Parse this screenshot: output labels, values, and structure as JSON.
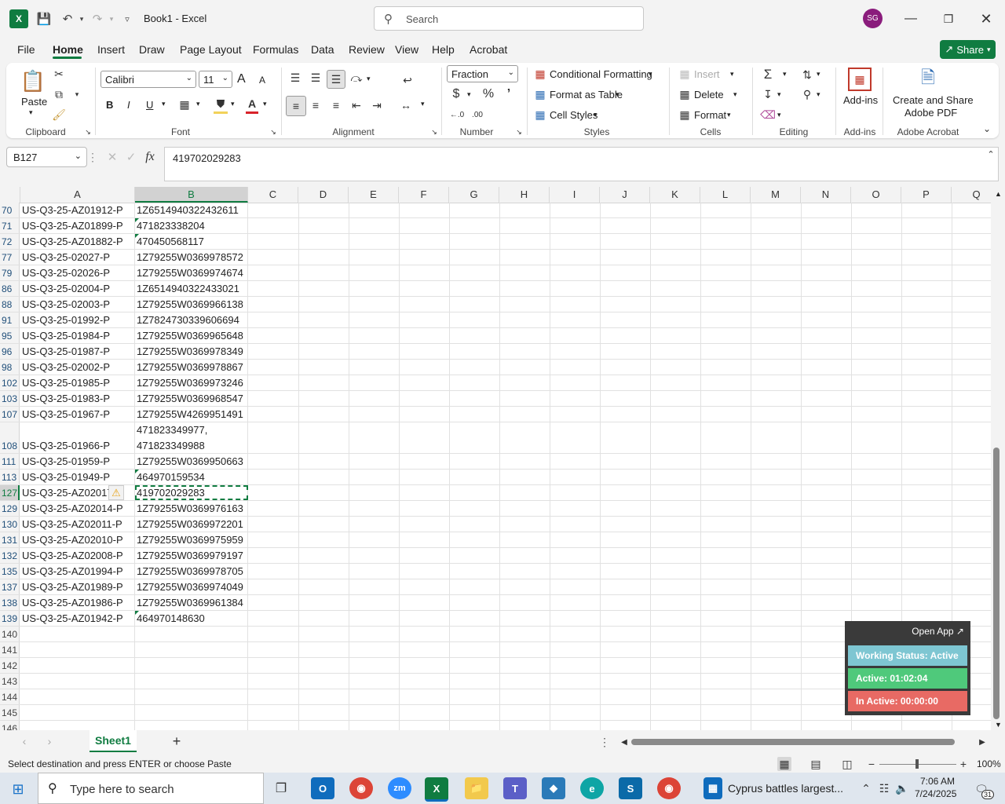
{
  "titlebar": {
    "title": "Book1  -  Excel",
    "search_placeholder": "Search",
    "avatar_initials": "SG"
  },
  "menu": {
    "tabs": [
      "File",
      "Home",
      "Insert",
      "Draw",
      "Page Layout",
      "Formulas",
      "Data",
      "Review",
      "View",
      "Help",
      "Acrobat"
    ],
    "share": "Share"
  },
  "ribbon": {
    "clipboard": {
      "paste": "Paste",
      "label": "Clipboard"
    },
    "font": {
      "name": "Calibri",
      "size": "11",
      "label": "Font",
      "bold": "B",
      "italic": "I",
      "underline": "U",
      "grow": "A",
      "shrink": "A"
    },
    "alignment": {
      "label": "Alignment"
    },
    "number": {
      "format": "Fraction",
      "label": "Number"
    },
    "styles": {
      "conditional": "Conditional Formatting",
      "format_table": "Format as Table",
      "cell_styles": "Cell Styles",
      "label": "Styles"
    },
    "cells": {
      "insert": "Insert",
      "delete": "Delete",
      "format": "Format",
      "label": "Cells"
    },
    "editing": {
      "label": "Editing"
    },
    "addins": {
      "button": "Add-ins",
      "label": "Add-ins"
    },
    "acrobat": {
      "line1": "Create and Share",
      "line2": "Adobe PDF",
      "label": "Adobe Acrobat"
    }
  },
  "formula_bar": {
    "name_box": "B127",
    "fx": "fx",
    "value": "419702029283"
  },
  "columns": [
    "A",
    "B",
    "C",
    "D",
    "E",
    "F",
    "G",
    "H",
    "I",
    "J",
    "K",
    "L",
    "M",
    "N",
    "O",
    "P",
    "Q"
  ],
  "rows": [
    {
      "num": "70",
      "a": "US-Q3-25-AZ01912-P",
      "b": "1Z6514940322432611",
      "tri": false
    },
    {
      "num": "71",
      "a": "US-Q3-25-AZ01899-P",
      "b": "471823338204",
      "tri": true
    },
    {
      "num": "72",
      "a": "US-Q3-25-AZ01882-P",
      "b": "470450568117",
      "tri": true
    },
    {
      "num": "77",
      "a": "US-Q3-25-02027-P",
      "b": "1Z79255W0369978572",
      "tri": false
    },
    {
      "num": "79",
      "a": "US-Q3-25-02026-P",
      "b": "1Z79255W0369974674",
      "tri": false
    },
    {
      "num": "86",
      "a": "US-Q3-25-02004-P",
      "b": "1Z6514940322433021",
      "tri": false
    },
    {
      "num": "88",
      "a": "US-Q3-25-02003-P",
      "b": "1Z79255W0369966138",
      "tri": false
    },
    {
      "num": "91",
      "a": "US-Q3-25-01992-P",
      "b": "1Z7824730339606694",
      "tri": false
    },
    {
      "num": "95",
      "a": "US-Q3-25-01984-P",
      "b": "1Z79255W0369965648",
      "tri": false
    },
    {
      "num": "96",
      "a": "US-Q3-25-01987-P",
      "b": "1Z79255W0369978349",
      "tri": false
    },
    {
      "num": "98",
      "a": "US-Q3-25-02002-P",
      "b": "1Z79255W0369978867",
      "tri": false
    },
    {
      "num": "102",
      "a": "US-Q3-25-01985-P",
      "b": "1Z79255W0369973246",
      "tri": false
    },
    {
      "num": "103",
      "a": "US-Q3-25-01983-P",
      "b": "1Z79255W0369968547",
      "tri": false
    },
    {
      "num": "107",
      "a": "US-Q3-25-01967-P",
      "b": "1Z79255W4269951491",
      "tri": false
    }
  ],
  "row108": {
    "num": "108",
    "a": "US-Q3-25-01966-P",
    "b1": "471823349977,",
    "b2": "471823349988"
  },
  "rows2": [
    {
      "num": "111",
      "a": "US-Q3-25-01959-P",
      "b": "1Z79255W0369950663",
      "tri": false
    },
    {
      "num": "113",
      "a": "US-Q3-25-01949-P",
      "b": "464970159534",
      "tri": true
    },
    {
      "num": "127",
      "a": "US-Q3-25-AZ02017",
      "b": "419702029283",
      "tri": false
    },
    {
      "num": "129",
      "a": "US-Q3-25-AZ02014-P",
      "b": "1Z79255W0369976163",
      "tri": false
    },
    {
      "num": "130",
      "a": "US-Q3-25-AZ02011-P",
      "b": "1Z79255W0369972201",
      "tri": false
    },
    {
      "num": "131",
      "a": "US-Q3-25-AZ02010-P",
      "b": "1Z79255W0369975959",
      "tri": false
    },
    {
      "num": "132",
      "a": "US-Q3-25-AZ02008-P",
      "b": "1Z79255W0369979197",
      "tri": false
    },
    {
      "num": "135",
      "a": "US-Q3-25-AZ01994-P",
      "b": "1Z79255W0369978705",
      "tri": false
    },
    {
      "num": "137",
      "a": "US-Q3-25-AZ01989-P",
      "b": "1Z79255W0369974049",
      "tri": false
    },
    {
      "num": "138",
      "a": "US-Q3-25-AZ01986-P",
      "b": "1Z79255W0369961384",
      "tri": false
    },
    {
      "num": "139",
      "a": "US-Q3-25-AZ01942-P",
      "b": "464970148630",
      "tri": true
    },
    {
      "num": "140",
      "a": "",
      "b": "",
      "tri": false
    },
    {
      "num": "141",
      "a": "",
      "b": "",
      "tri": false
    },
    {
      "num": "142",
      "a": "",
      "b": "",
      "tri": false
    },
    {
      "num": "143",
      "a": "",
      "b": "",
      "tri": false
    },
    {
      "num": "144",
      "a": "",
      "b": "",
      "tri": false
    },
    {
      "num": "145",
      "a": "",
      "b": "",
      "tri": false
    },
    {
      "num": "146",
      "a": "",
      "b": "",
      "tri": false
    }
  ],
  "sheet": {
    "tab": "Sheet1",
    "add": "+"
  },
  "status": {
    "message": "Select destination and press ENTER or choose Paste",
    "zoom": "100%"
  },
  "widget": {
    "open_app": "Open App ↗",
    "status": "Working Status: Active",
    "active": "Active: 01:02:04",
    "inactive": "In Active: 00:00:00"
  },
  "taskbar": {
    "search": "Type here to search",
    "news": "Cyprus battles largest...",
    "time": "7:06 AM",
    "date": "7/24/2025",
    "notif": "31"
  },
  "colors": {
    "excel_green": "#107c41",
    "status_active": "#7ec6d2",
    "active_green": "#4fc97b",
    "inactive_red": "#e86a64"
  }
}
